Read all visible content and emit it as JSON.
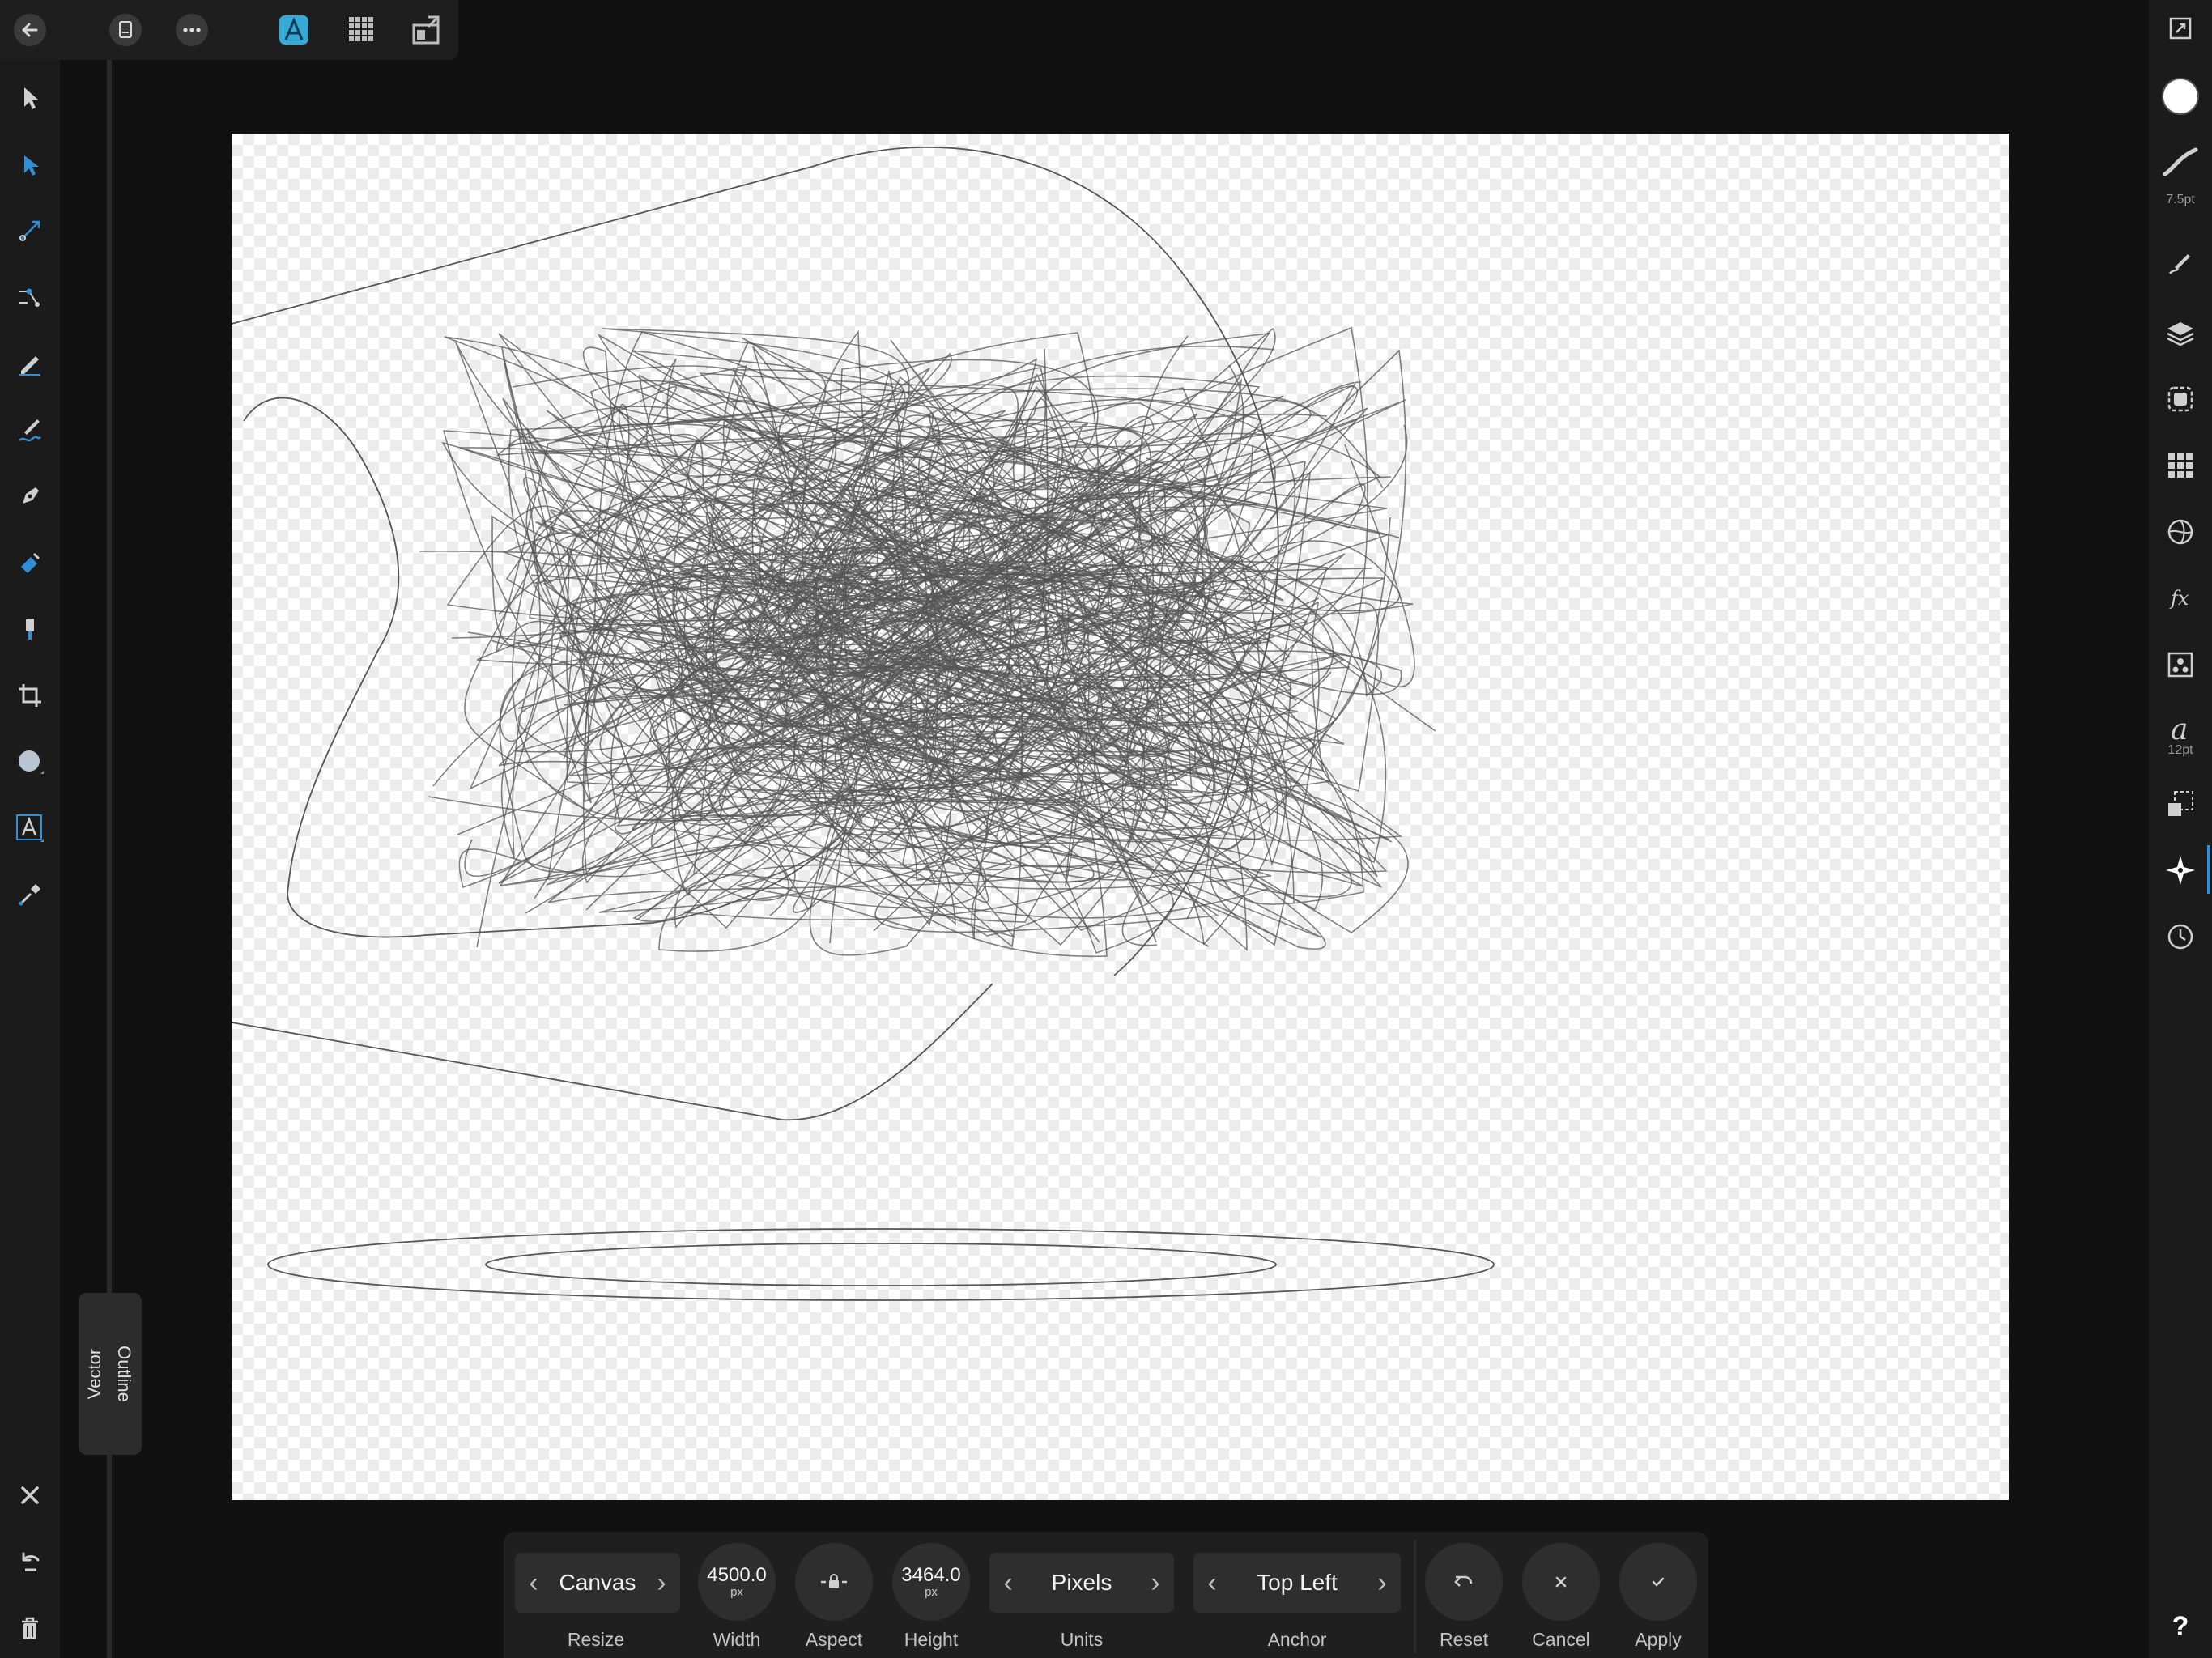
{
  "context_toolbar": {
    "vector_label": "Vector",
    "outline_label": "Outline"
  },
  "right_studio": {
    "brush_width": "7.5pt",
    "text_size": "12pt"
  },
  "resize_panel": {
    "mode": {
      "value": "Canvas",
      "label": "Resize"
    },
    "width": {
      "value": "4500.0",
      "unit": "px",
      "label": "Width"
    },
    "aspect": {
      "label": "Aspect"
    },
    "height": {
      "value": "3464.0",
      "unit": "px",
      "label": "Height"
    },
    "units": {
      "value": "Pixels",
      "label": "Units"
    },
    "anchor": {
      "value": "Top Left",
      "label": "Anchor"
    },
    "reset_label": "Reset",
    "cancel_label": "Cancel",
    "apply_label": "Apply"
  },
  "help_label": "?",
  "colors": {
    "accent": "#2f8fd6",
    "app_icon": "#36a9d6",
    "panel_bg": "#1f1f1f",
    "canvas_bg": "#ffffff"
  }
}
